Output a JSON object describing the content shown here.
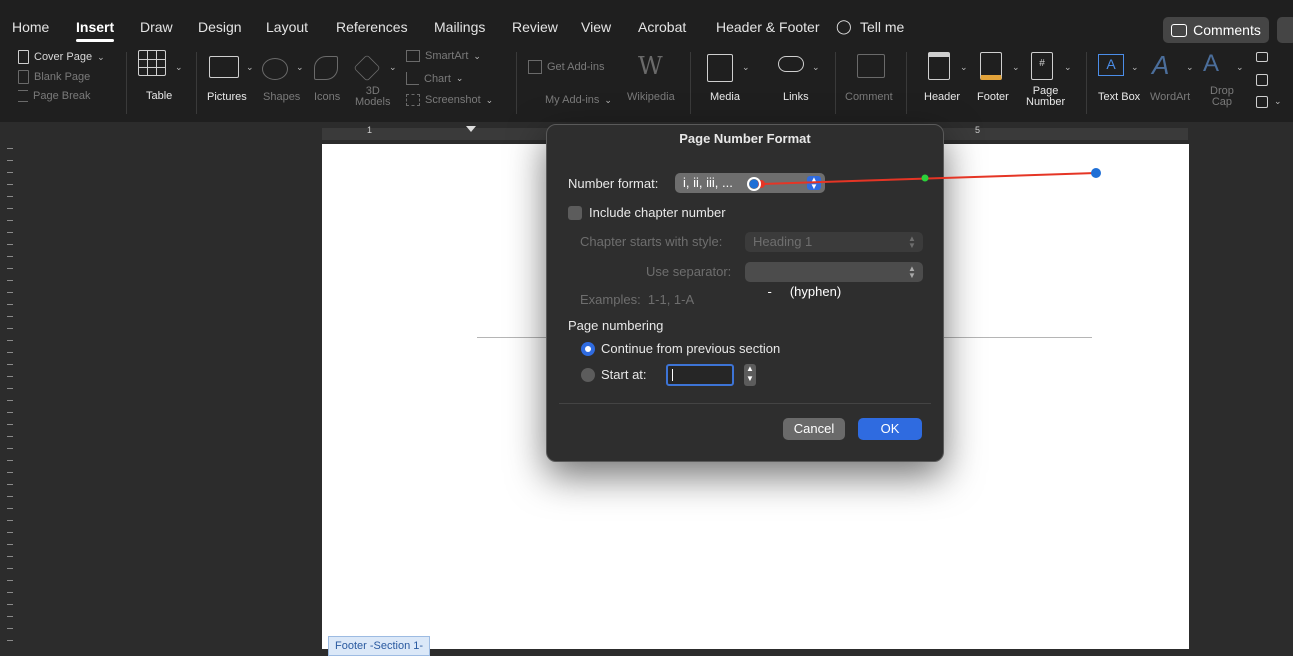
{
  "tabs": [
    "Home",
    "Insert",
    "Draw",
    "Design",
    "Layout",
    "References",
    "Mailings",
    "Review",
    "View",
    "Acrobat",
    "Header & Footer",
    "Tell me"
  ],
  "active_tab": "Insert",
  "comments_label": "Comments",
  "ribbon": {
    "pages": [
      "Cover Page",
      "Blank Page",
      "Page Break"
    ],
    "table": "Table",
    "pictures": "Pictures",
    "shapes": "Shapes",
    "icons": "Icons",
    "models_3d": "3D\nModels",
    "smartart": "SmartArt",
    "chart": "Chart",
    "screenshot": "Screenshot",
    "get_addins": "Get Add-ins",
    "my_addins": "My Add-ins",
    "wikipedia": "Wikipedia",
    "media": "Media",
    "links": "Links",
    "comment": "Comment",
    "header": "Header",
    "footer": "Footer",
    "page_number": "Page\nNumber",
    "text_box": "Text Box",
    "wordart": "WordArt",
    "drop_cap": "Drop\nCap"
  },
  "ruler_numbers": [
    "1",
    "5"
  ],
  "page": {
    "footer_tag": "Footer -Section 1-"
  },
  "dialog": {
    "title": "Page Number Format",
    "number_format_label": "Number format:",
    "number_format_value": "i, ii, iii, ...",
    "include_chapter_label": "Include chapter number",
    "chapter_style_label": "Chapter starts with style:",
    "chapter_style_value": "Heading 1",
    "separator_label": "Use separator:",
    "separator_value": "-     (hyphen)",
    "examples_label": "Examples:  1-1, 1-A",
    "page_numbering_label": "Page numbering",
    "continue_label": "Continue from previous section",
    "start_at_label": "Start at:",
    "start_at_value": "",
    "cancel_label": "Cancel",
    "ok_label": "OK"
  },
  "colors": {
    "accent": "#2f6be0",
    "annotation_line": "#e53525",
    "annotation_dot": "#1f6fd6",
    "annotation_mid": "#2bd13a"
  }
}
